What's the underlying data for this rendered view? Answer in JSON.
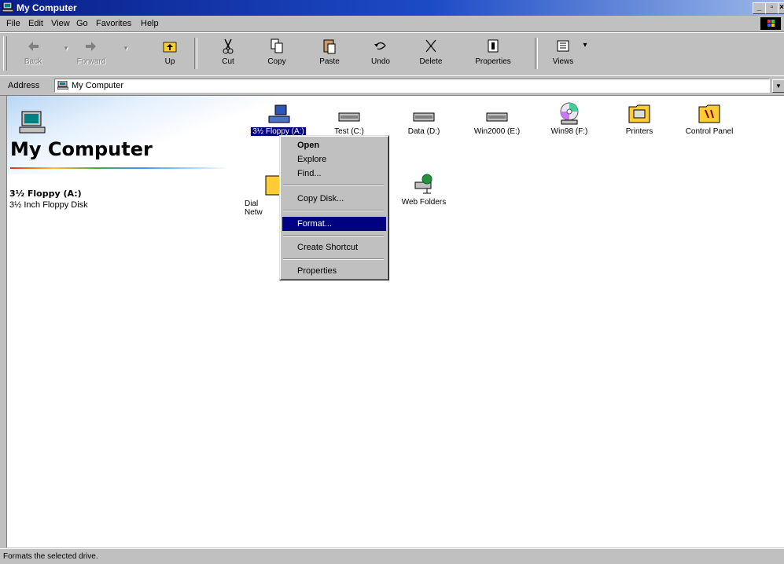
{
  "window": {
    "title": "My Computer",
    "buttons": [
      "_",
      "ō",
      "×"
    ]
  },
  "menubar": [
    "File",
    "Edit",
    "View",
    "Go",
    "Favorites",
    "Help"
  ],
  "toolbar": {
    "back": "Back",
    "forward": "Forward",
    "up": "Up",
    "cut": "Cut",
    "copy": "Copy",
    "paste": "Paste",
    "undo": "Undo",
    "delete": "Delete",
    "properties": "Properties",
    "views": "Views"
  },
  "address": {
    "label": "Address",
    "value": "My Computer"
  },
  "webview": {
    "title": "My Computer",
    "selected_name": "3½ Floppy (A:)",
    "selected_desc": "3½ Inch Floppy Disk"
  },
  "drives": [
    {
      "label": "3½ Floppy (A:)",
      "icon": "floppy-icon",
      "selected": true
    },
    {
      "label": "Test (C:)",
      "icon": "hard-drive-icon"
    },
    {
      "label": "Data (D:)",
      "icon": "hard-drive-icon"
    },
    {
      "label": "Win2000 (E:)",
      "icon": "hard-drive-icon"
    },
    {
      "label": "Win98 (F:)",
      "icon": "cd-rom-icon"
    },
    {
      "label": "Printers",
      "icon": "printers-folder-icon"
    },
    {
      "label": "Control Panel",
      "icon": "control-panel-icon"
    },
    {
      "label": "Dial-Up Networking",
      "icon": "dialup-networking-icon"
    },
    {
      "label": "Web Folders",
      "icon": "web-folders-icon"
    }
  ],
  "dialup_visible": [
    "Dial",
    "Netw"
  ],
  "context_menu": [
    "Open",
    "Explore",
    "Find...",
    "Copy Disk...",
    "Format...",
    "Create Shortcut",
    "Properties"
  ],
  "status": "Formats the selected drive.",
  "colors": {
    "titlebar": "#0a1f8a",
    "highlight": "#000080",
    "face": "#c0c0c0"
  }
}
